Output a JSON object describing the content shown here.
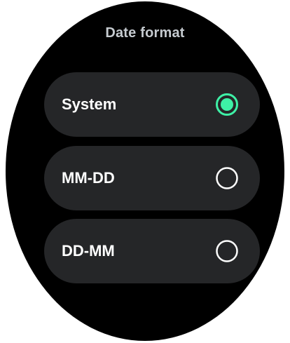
{
  "screen": {
    "title": "Date format"
  },
  "options": [
    {
      "label": "System",
      "selected": true
    },
    {
      "label": "MM-DD",
      "selected": false
    },
    {
      "label": "DD-MM",
      "selected": false
    }
  ],
  "colors": {
    "background": "#000000",
    "card": "#252628",
    "title": "#c6cbd0",
    "text": "#ffffff",
    "accent": "#3ef0a6",
    "radio_outline": "#ffffff"
  },
  "icons": {
    "selected": "radio-checked-icon",
    "unselected": "radio-unchecked-icon"
  }
}
